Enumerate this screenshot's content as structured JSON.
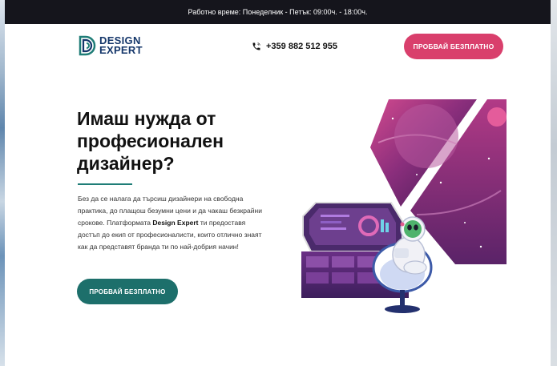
{
  "topbar": {
    "hours": "Работно време: Понеделник - Петък: 09:00ч. - 18:00ч."
  },
  "header": {
    "logo_line1": "DESIGN",
    "logo_line2": "EXPERT",
    "phone": "+359 882 512 955",
    "cta_label": "ПРОБВАЙ БЕЗПЛАТНО"
  },
  "hero": {
    "title_line1": "Имаш нужда от",
    "title_line2": "професионален",
    "title_line3": "дизайнер?",
    "text_part1": "Без да се налага да търсиш дизайнери на свободна практика, до плащош безумни цени и да чакаш безкрайни срокове. Платформата ",
    "text_brand": "Design Expert",
    "text_part2": " ти предоставя достъп до екип от професионалисти, които отлично знаят как да представят бранда ти по най-добрия начин!",
    "cta_label": "ПРОБВАЙ БЕЗПЛАТНО"
  },
  "colors": {
    "brand_navy": "#14366a",
    "cta_pink": "#d93f6c",
    "cta_teal": "#1d6f6b",
    "topbar_bg": "#15151c"
  },
  "icons": {
    "phone": "phone-icon",
    "logo": "design-expert-logo-icon"
  }
}
